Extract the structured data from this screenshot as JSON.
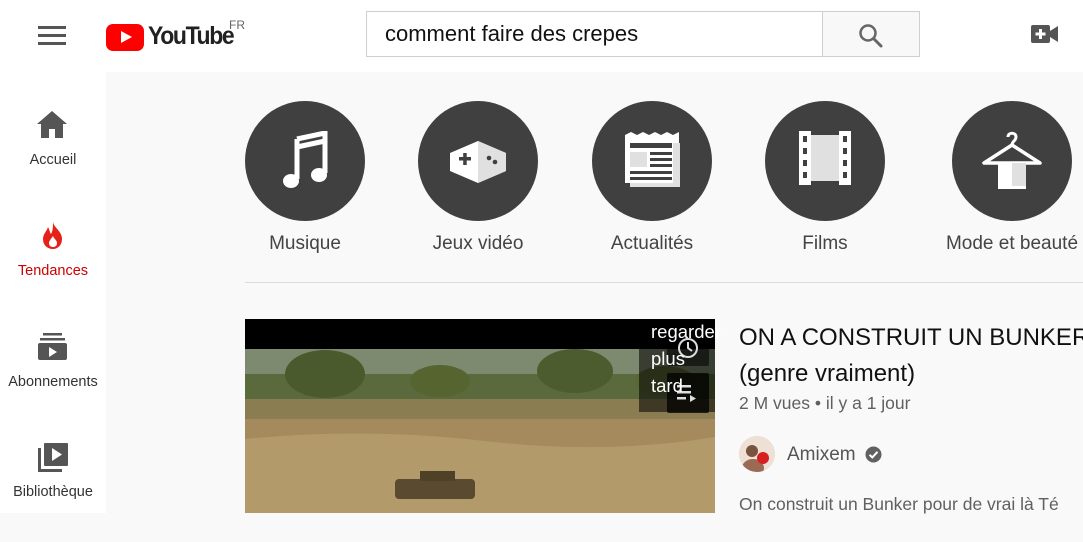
{
  "header": {
    "logo_text": "YouTube",
    "country_code": "FR",
    "search_value": "comment faire des crepes"
  },
  "sidebar": {
    "items": [
      {
        "label": "Accueil",
        "icon": "home-icon"
      },
      {
        "label": "Tendances",
        "icon": "flame-icon",
        "active": true
      },
      {
        "label": "Abonnements",
        "icon": "subscriptions-icon"
      },
      {
        "label": "Bibliothèque",
        "icon": "library-icon"
      }
    ]
  },
  "categories": [
    {
      "label": "Musique",
      "icon": "music-note-icon"
    },
    {
      "label": "Jeux vidéo",
      "icon": "gamepad-icon"
    },
    {
      "label": "Actualités",
      "icon": "newspaper-icon"
    },
    {
      "label": "Films",
      "icon": "film-strip-icon"
    },
    {
      "label": "Mode et beauté",
      "icon": "hanger-icon"
    }
  ],
  "video": {
    "title_line1": "ON A CONSTRUIT UN BUNKER",
    "title_line2": "(genre vraiment)",
    "meta": "2 M vues • il y a 1 jour",
    "channel": "Amixem",
    "watch_later_label": "regarder\nplus\ntard",
    "description": "On construit un Bunker pour de vrai là Té"
  },
  "colors": {
    "brand_red": "#ff0000",
    "active_red": "#cc0000",
    "category_circle": "#404040"
  }
}
